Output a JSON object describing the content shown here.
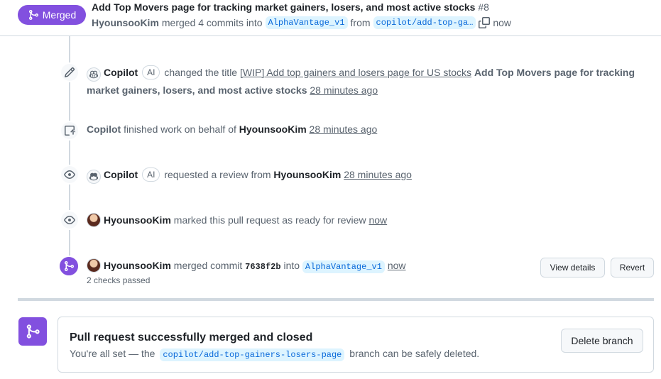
{
  "header": {
    "status_badge": "Merged",
    "title": "Add Top Movers page for tracking market gainers, losers, and most active stocks",
    "number": "#8",
    "author": "HyounsooKim",
    "merged_text": "merged 4 commits into",
    "base_branch": "AlphaVantage_v1",
    "from_text": "from",
    "head_branch": "copilot/add-top-ga…",
    "time": "now"
  },
  "timeline": {
    "event1": {
      "actor": "Copilot",
      "ai_badge": "AI",
      "action": "changed the title",
      "old_title": "[WIP] Add top gainers and losers page for US stocks",
      "new_title": "Add Top Movers page for tracking market gainers, losers, and most active stocks",
      "time": "28 minutes ago"
    },
    "event2": {
      "actor": "Copilot",
      "action": "finished work on behalf of",
      "target": "HyounsooKim",
      "time": "28 minutes ago"
    },
    "event3": {
      "actor": "Copilot",
      "ai_badge": "AI",
      "action": "requested a review from",
      "target": "HyounsooKim",
      "time": "28 minutes ago"
    },
    "event4": {
      "actor": "HyounsooKim",
      "action": "marked this pull request as ready for review",
      "time": "now"
    },
    "event5": {
      "actor": "HyounsooKim",
      "action": "merged commit",
      "sha": "7638f2b",
      "into_text": "into",
      "branch": "AlphaVantage_v1",
      "time": "now",
      "checks": "2 checks passed",
      "view_details_label": "View details",
      "revert_label": "Revert"
    }
  },
  "merge_box": {
    "title": "Pull request successfully merged and closed",
    "desc_prefix": "You're all set — the",
    "branch": "copilot/add-top-gainers-losers-page",
    "desc_suffix": "branch can be safely deleted.",
    "delete_label": "Delete branch"
  },
  "colors": {
    "merged_purple": "#8250df",
    "branch_blue": "#0969da",
    "branch_bg": "#ddf4ff"
  },
  "icons": {
    "merge": "git-merge-icon",
    "pencil": "pencil-icon",
    "workflow": "task-exit-icon",
    "eye": "eye-icon",
    "copy": "copy-icon",
    "copilot": "copilot-icon"
  }
}
